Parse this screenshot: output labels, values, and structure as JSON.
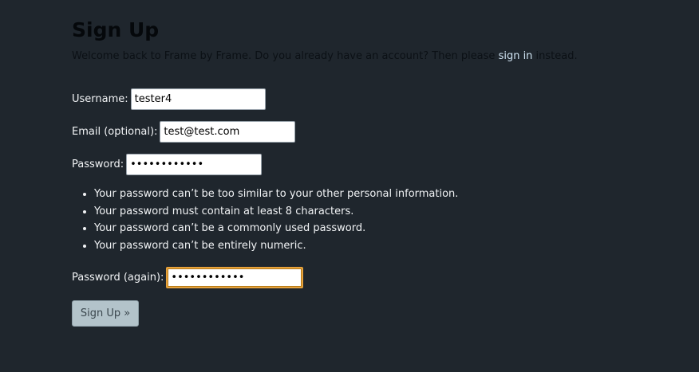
{
  "page": {
    "title": "Sign Up",
    "intro_before": "Welcome back to Frame by Frame. Do you already have an account? Then please ",
    "intro_link": "sign in",
    "intro_after": " instead."
  },
  "form": {
    "username_label": "Username:",
    "username_value": "tester4",
    "email_label": "Email (optional):",
    "email_value": "test@test.com",
    "password_label": "Password:",
    "password_value": "••••••••••••",
    "password_help": [
      "Your password can’t be too similar to your other personal information.",
      "Your password must contain at least 8 characters.",
      "Your password can’t be a commonly used password.",
      "Your password can’t be entirely numeric."
    ],
    "password2_label": "Password (again):",
    "password2_value": "••••••••••••",
    "submit_label": "Sign Up »"
  },
  "colors": {
    "background": "#1f262d",
    "focus_border": "#e6a23c",
    "button_bg": "#b3c3ca"
  }
}
